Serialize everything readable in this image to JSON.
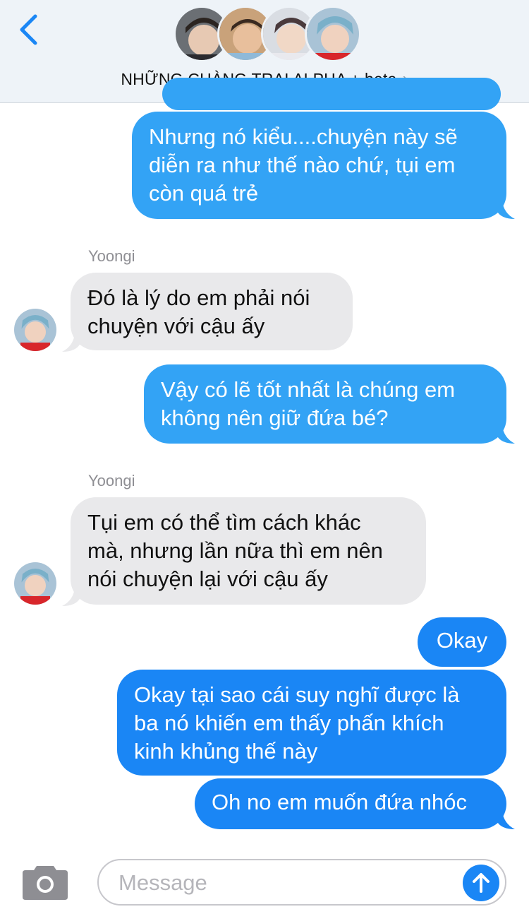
{
  "header": {
    "back_icon": "chevron-left-icon",
    "group_title": "NHỮNG CHÀNG TRAI ALPHA + beta",
    "title_chevron": "›",
    "avatar_count": 4
  },
  "messages": [
    {
      "type": "outgoing",
      "text_lines": [
        "Nhưng nó kiểu....chuyện này sẽ",
        "diễn ra như thế nào chứ, tụi em",
        "còn quá trẻ"
      ]
    },
    {
      "type": "incoming",
      "sender": "Yoongi",
      "text_lines": [
        "Đó là lý do em phải nói",
        "chuyện với cậu ấy"
      ]
    },
    {
      "type": "outgoing",
      "text_lines": [
        "Vậy có lẽ tốt nhất là chúng em",
        "không nên giữ đứa bé?"
      ]
    },
    {
      "type": "incoming",
      "sender": "Yoongi",
      "text_lines": [
        "Tụi em có thể tìm cách khác",
        "mà, nhưng lần nữa thì em nên",
        "nói chuyện lại với cậu ấy"
      ]
    },
    {
      "type": "outgoing",
      "text_lines": [
        "Okay"
      ]
    },
    {
      "type": "outgoing",
      "text_lines": [
        "Okay tại sao cái suy nghĩ được là",
        "ba nó khiến em thấy phấn khích",
        "kinh khủng thế này"
      ]
    },
    {
      "type": "outgoing",
      "text_lines": [
        "Oh no em muốn đứa nhóc"
      ]
    }
  ],
  "composer": {
    "placeholder": "Message",
    "camera_icon": "camera-icon",
    "send_icon": "arrow-up-icon"
  },
  "colors": {
    "outgoing_light": "#33a3f5",
    "outgoing_dark": "#1a86f5",
    "incoming": "#e9e9eb",
    "accent": "#1a86f5"
  }
}
